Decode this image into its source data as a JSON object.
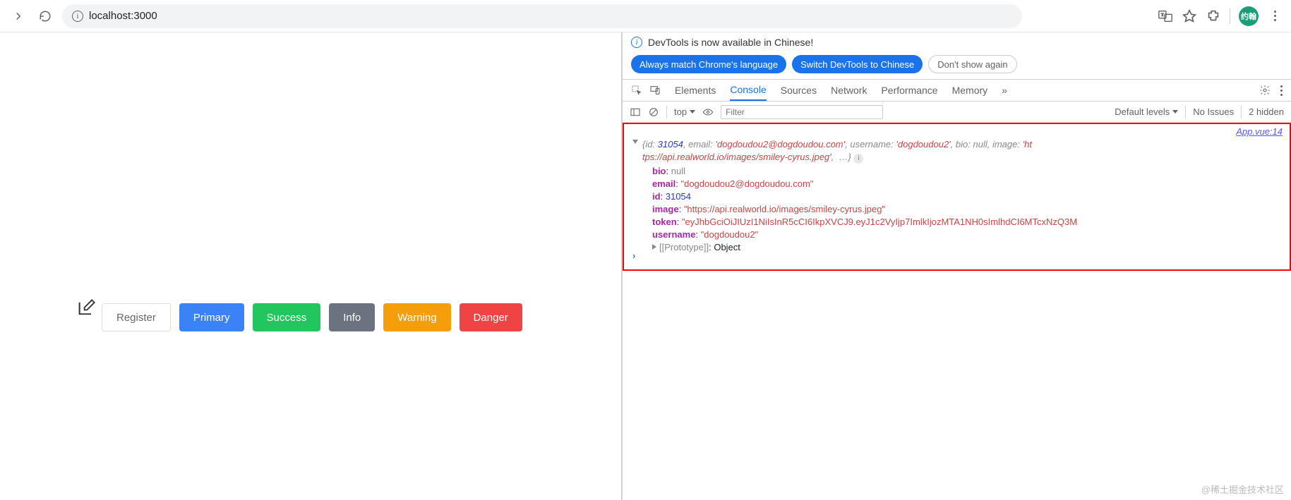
{
  "browser": {
    "url": "localhost:3000",
    "avatar_text": "约翰"
  },
  "page": {
    "buttons": {
      "register": "Register",
      "primary": "Primary",
      "success": "Success",
      "info": "Info",
      "warning": "Warning",
      "danger": "Danger"
    }
  },
  "devtools": {
    "notice": "DevTools is now available in Chinese!",
    "pills": {
      "match": "Always match Chrome's language",
      "switch": "Switch DevTools to Chinese",
      "dismiss": "Don't show again"
    },
    "tabs": {
      "elements": "Elements",
      "console": "Console",
      "sources": "Sources",
      "network": "Network",
      "performance": "Performance",
      "memory": "Memory",
      "more": "»"
    },
    "filter": {
      "context": "top",
      "placeholder": "Filter",
      "levels": "Default levels",
      "issues": "No Issues",
      "hidden": "2 hidden"
    },
    "console": {
      "src_link": "App.vue:14",
      "summary_line1": "{id: 31054, email: 'dogdoudou2@dogdoudou.com', username: 'dogdoudou2', bio: null, image: 'ht",
      "summary_line2": "tps://api.realworld.io/images/smiley-cyrus.jpeg',  …}",
      "object": {
        "bio_k": "bio",
        "bio_v": "null",
        "email_k": "email",
        "email_v": "\"dogdoudou2@dogdoudou.com\"",
        "id_k": "id",
        "id_v": "31054",
        "image_k": "image",
        "image_v": "\"https://api.realworld.io/images/smiley-cyrus.jpeg\"",
        "token_k": "token",
        "token_v": "\"eyJhbGciOiJIUzI1NiIsInR5cCI6IkpXVCJ9.eyJ1c2VyIjp7ImlkIjozMTA1NH0sImlhdCI6MTcxNzQ3M",
        "username_k": "username",
        "username_v": "\"dogdoudou2\"",
        "proto_k": "[[Prototype]]",
        "proto_v": "Object"
      }
    }
  },
  "watermark": "@稀土掘金技术社区"
}
